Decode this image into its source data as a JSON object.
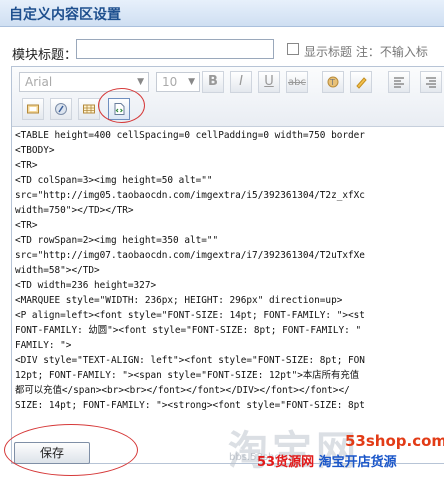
{
  "header": {
    "title": "自定义内容区设置"
  },
  "form": {
    "module_title_label": "模块标题：",
    "module_title_value": "",
    "show_title_label": "显示标题 注：不输入标",
    "save_label": "保存"
  },
  "toolbar": {
    "font_family": "Arial",
    "font_size": "10",
    "icons": [
      "bold-icon",
      "italic-icon",
      "underline-icon",
      "strikethrough-icon",
      "font-color-icon",
      "highlight-icon",
      "align-left-icon",
      "insert-image-icon",
      "insert-flash-icon",
      "insert-table-icon",
      "source-code-icon"
    ]
  },
  "editor_lines": [
    "<TABLE height=400 cellSpacing=0 cellPadding=0 width=750 border",
    "<TBODY>",
    "<TR>",
    "<TD colSpan=3><img height=50 alt=\"\"",
    "src=\"http://img05.taobaocdn.com/imgextra/i5/392361304/T2z_xfXc",
    "width=750\"></TD></TR>",
    "<TR>",
    "<TD rowSpan=2><img height=350 alt=\"\"",
    "src=\"http://img07.taobaocdn.com/imgextra/i7/392361304/T2uTxfXe",
    "width=58\"></TD>",
    "<TD width=236 height=327>",
    "<MARQUEE style=\"WIDTH: 236px; HEIGHT: 296px\" direction=up>",
    "<P align=left><font style=\"FONT-SIZE: 14pt; FONT-FAMILY: \"><st",
    "FONT-FAMILY: 幼圆\"><font style=\"FONT-SIZE: 8pt; FONT-FAMILY: \"",
    "FAMILY: \">",
    "<DIV style=\"TEXT-ALIGN: left\"><font style=\"FONT-SIZE: 8pt; FON",
    "12pt; FONT-FAMILY: \"><span style=\"FONT-SIZE: 12pt\">本店所有充值",
    "都可以充值</span><br><br></font></font></DIV></font></font></",
    "SIZE: 14pt; FONT-FAMILY: \"><strong><font style=\"FONT-SIZE: 8pt"
  ],
  "watermark": {
    "big": "淘宝网",
    "small": "bbs.53shop.com",
    "site": "53shop.com",
    "slogan_a": "53货源网",
    "slogan_b": "淘宝开店货源"
  },
  "colors": {
    "accent": "#1e4f8e",
    "annotation": "#d63a3a"
  }
}
